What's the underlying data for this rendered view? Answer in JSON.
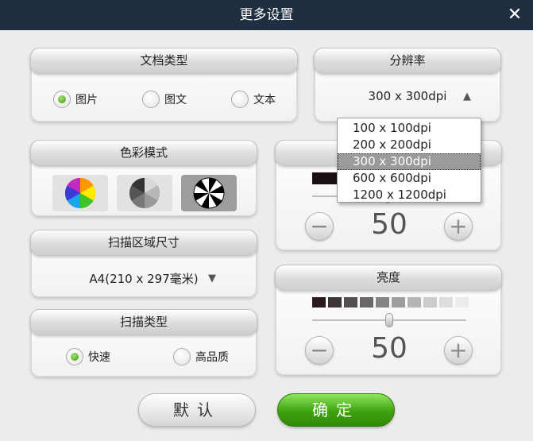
{
  "window": {
    "title": "更多设置",
    "close_glyph": "✕"
  },
  "doc_type": {
    "title": "文档类型",
    "options": [
      {
        "label": "图片",
        "selected": true
      },
      {
        "label": "图文",
        "selected": false
      },
      {
        "label": "文本",
        "selected": false
      }
    ]
  },
  "resolution": {
    "title": "分辨率",
    "value": "300 x 300dpi",
    "arrow": "▲",
    "options": [
      "100 x 100dpi",
      "200 x 200dpi",
      "300 x 300dpi",
      "600 x 600dpi",
      "1200 x 1200dpi"
    ],
    "selected_index": 2
  },
  "color_mode": {
    "title": "色彩模式",
    "modes": [
      {
        "icon": "color-wheel-icon"
      },
      {
        "icon": "grayscale-wheel-icon"
      },
      {
        "icon": "black-white-wheel-icon",
        "selected": true
      }
    ]
  },
  "contrast": {
    "value": "50",
    "level": 50,
    "minus": "−",
    "plus": "+"
  },
  "scan_area": {
    "title": "扫描区域尺寸",
    "value": "A4(210 x 297毫米)",
    "arrow": "▼"
  },
  "scan_type": {
    "title": "扫描类型",
    "options": [
      {
        "label": "快速",
        "selected": true
      },
      {
        "label": "高品质",
        "selected": false
      }
    ]
  },
  "brightness": {
    "title": "亮度",
    "value": "50",
    "level": 50,
    "minus": "−",
    "plus": "+",
    "swatches": [
      "#2a1a1a",
      "#3d3535",
      "#555050",
      "#6c6868",
      "#858383",
      "#9e9d9d",
      "#b6b6b6",
      "#cccccc",
      "#dddddd",
      "#ececec"
    ]
  },
  "buttons": {
    "default": "默认",
    "ok": "确定"
  },
  "colors": {
    "titlebar": "#1f2e40",
    "accent_green": "#3ea10f"
  }
}
